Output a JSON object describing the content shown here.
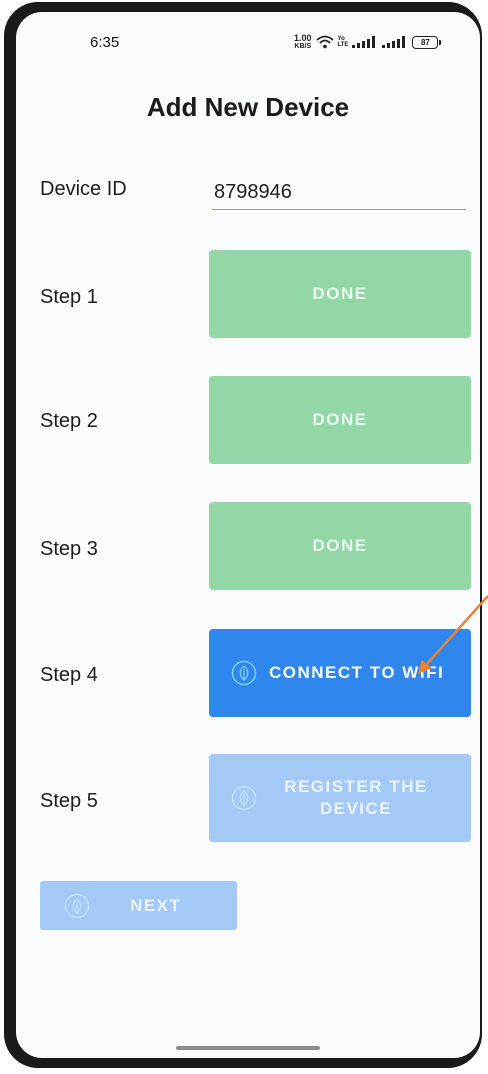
{
  "status_bar": {
    "time": "6:35",
    "net_speed_value": "1.00",
    "net_speed_unit": "KB/S",
    "volte_top": "Yo",
    "volte_bottom": "LTE",
    "battery": "87"
  },
  "header": {
    "title": "Add New Device"
  },
  "device_id": {
    "label": "Device ID",
    "value": "8798946"
  },
  "steps": [
    {
      "label": "Step 1",
      "button": "DONE",
      "state": "done"
    },
    {
      "label": "Step 2",
      "button": "DONE",
      "state": "done"
    },
    {
      "label": "Step 3",
      "button": "DONE",
      "state": "done"
    },
    {
      "label": "Step 4",
      "button": "CONNECT TO WIFI",
      "state": "active",
      "icon": "leaf-icon"
    },
    {
      "label": "Step 5",
      "button_line1": "REGISTER THE",
      "button_line2": "DEVICE",
      "state": "disabled",
      "icon": "leaf-icon"
    }
  ],
  "footer": {
    "next_label": "NEXT",
    "next_icon": "leaf-icon"
  },
  "colors": {
    "done": "#93d7a7",
    "active": "#2f86ec",
    "disabled": "#a4c9f6",
    "annotation_arrow": "#e8833a"
  }
}
